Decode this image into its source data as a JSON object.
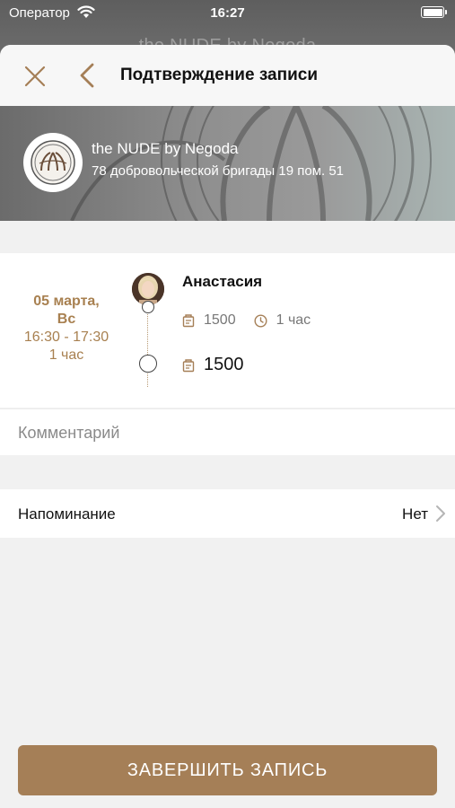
{
  "status_bar": {
    "carrier": "Оператор",
    "time": "16:27"
  },
  "background": {
    "title": "the NUDE by Negoda"
  },
  "nav": {
    "title": "Подтверждение записи",
    "close_icon": "close-icon",
    "back_icon": "chevron-left-icon"
  },
  "salon": {
    "name": "the NUDE by Negoda",
    "address": "78 добровольческой бригады 19 пом. 51"
  },
  "booking": {
    "date": "05 марта,",
    "weekday": "Вс",
    "time_range": "16:30 - 17:30",
    "duration": "1 час",
    "master_name": "Анастасия",
    "service_price": "1500",
    "service_duration": "1 час",
    "total_price": "1500"
  },
  "comment": {
    "placeholder": "Комментарий"
  },
  "reminder": {
    "label": "Напоминание",
    "value": "Нет"
  },
  "actions": {
    "finish_label": "ЗАВЕРШИТЬ ЗАПИСЬ"
  },
  "colors": {
    "accent": "#a57f57",
    "date_text": "#a88050"
  }
}
